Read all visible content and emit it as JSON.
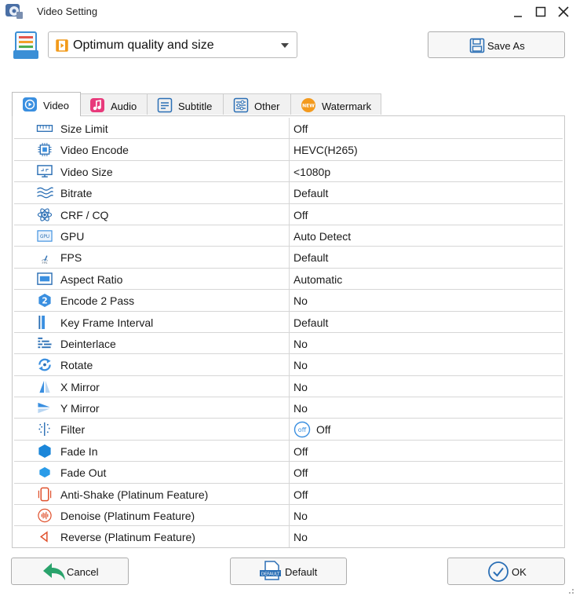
{
  "window": {
    "title": "Video Setting"
  },
  "preset": {
    "selected": "Optimum quality and size",
    "save_as_label": "Save As"
  },
  "tabs": [
    {
      "label": "Video",
      "icon": "video-icon",
      "active": true
    },
    {
      "label": "Audio",
      "icon": "music-icon",
      "active": false
    },
    {
      "label": "Subtitle",
      "icon": "subtitle-icon",
      "active": false
    },
    {
      "label": "Other",
      "icon": "sliders-icon",
      "active": false
    },
    {
      "label": "Watermark",
      "icon": "new-badge-icon",
      "badge": "NEW",
      "active": false
    }
  ],
  "settings": [
    {
      "name": "Size Limit",
      "value": "Off",
      "icon": "ruler-icon"
    },
    {
      "name": "Video Encode",
      "value": "HEVC(H265)",
      "icon": "chip-icon"
    },
    {
      "name": "Video Size",
      "value": "<1080p",
      "icon": "monitor-icon"
    },
    {
      "name": "Bitrate",
      "value": "Default",
      "icon": "waves-icon"
    },
    {
      "name": "CRF / CQ",
      "value": "Off",
      "icon": "atom-icon"
    },
    {
      "name": "GPU",
      "value": "Auto Detect",
      "icon": "gpu-icon",
      "icon_text": "GPU"
    },
    {
      "name": "FPS",
      "value": "Default",
      "icon": "fps-icon",
      "icon_text": "FPS"
    },
    {
      "name": "Aspect Ratio",
      "value": "Automatic",
      "icon": "aspect-ratio-icon"
    },
    {
      "name": "Encode 2 Pass",
      "value": "No",
      "icon": "two-pass-icon",
      "icon_text": "2"
    },
    {
      "name": "Key Frame Interval",
      "value": "Default",
      "icon": "keyframe-icon"
    },
    {
      "name": "Deinterlace",
      "value": "No",
      "icon": "deinterlace-icon"
    },
    {
      "name": "Rotate",
      "value": "No",
      "icon": "rotate-icon"
    },
    {
      "name": "X Mirror",
      "value": "No",
      "icon": "x-mirror-icon"
    },
    {
      "name": "Y Mirror",
      "value": "No",
      "icon": "y-mirror-icon"
    },
    {
      "name": "Filter",
      "value": "Off",
      "icon": "filter-icon",
      "badge": "off"
    },
    {
      "name": "Fade In",
      "value": "Off",
      "icon": "fade-in-icon"
    },
    {
      "name": "Fade Out",
      "value": "Off",
      "icon": "fade-out-icon"
    },
    {
      "name": "Anti-Shake (Platinum Feature)",
      "value": "Off",
      "icon": "anti-shake-icon"
    },
    {
      "name": "Denoise (Platinum Feature)",
      "value": "No",
      "icon": "denoise-icon"
    },
    {
      "name": "Reverse (Platinum Feature)",
      "value": "No",
      "icon": "reverse-icon"
    }
  ],
  "buttons": {
    "cancel": "Cancel",
    "default": "Default",
    "default_icon_text": "DEFAULT",
    "ok": "OK"
  },
  "colors": {
    "accent": "#1a6fb3",
    "blue_icon": "#2a8ad8",
    "green_arrow": "#2aa36c",
    "music_pink": "#e83a7b",
    "badge_orange": "#f39a1e",
    "red_icon": "#e0522e"
  }
}
